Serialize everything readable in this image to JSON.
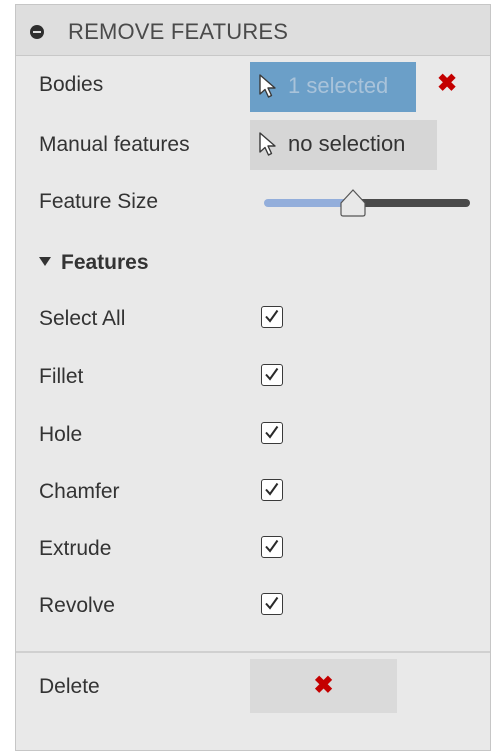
{
  "panel": {
    "title": "REMOVE FEATURES",
    "collapse_icon": "minus-circle-icon"
  },
  "bodies": {
    "label": "Bodies",
    "selection_text": "1 selected",
    "selection_icon": "arrow-cursor-icon",
    "clear_icon": "close-icon",
    "clear_glyph": "✖",
    "accent": "#6b9fc8",
    "clear_color": "#c40000"
  },
  "manual_features": {
    "label": "Manual features",
    "selection_text": "no selection",
    "selection_icon": "arrow-cursor-icon"
  },
  "feature_size": {
    "label": "Feature Size",
    "value_fraction": 0.42,
    "track_color": "#93aedb"
  },
  "features_section": {
    "label": "Features",
    "expanded_icon": "triangle-down-icon",
    "items": [
      {
        "label": "Select All",
        "checked": true
      },
      {
        "label": "Fillet",
        "checked": true
      },
      {
        "label": "Hole",
        "checked": true
      },
      {
        "label": "Chamfer",
        "checked": true
      },
      {
        "label": "Extrude",
        "checked": true
      },
      {
        "label": "Revolve",
        "checked": true
      }
    ]
  },
  "delete": {
    "label": "Delete",
    "button_icon": "close-icon",
    "button_glyph": "✖"
  }
}
